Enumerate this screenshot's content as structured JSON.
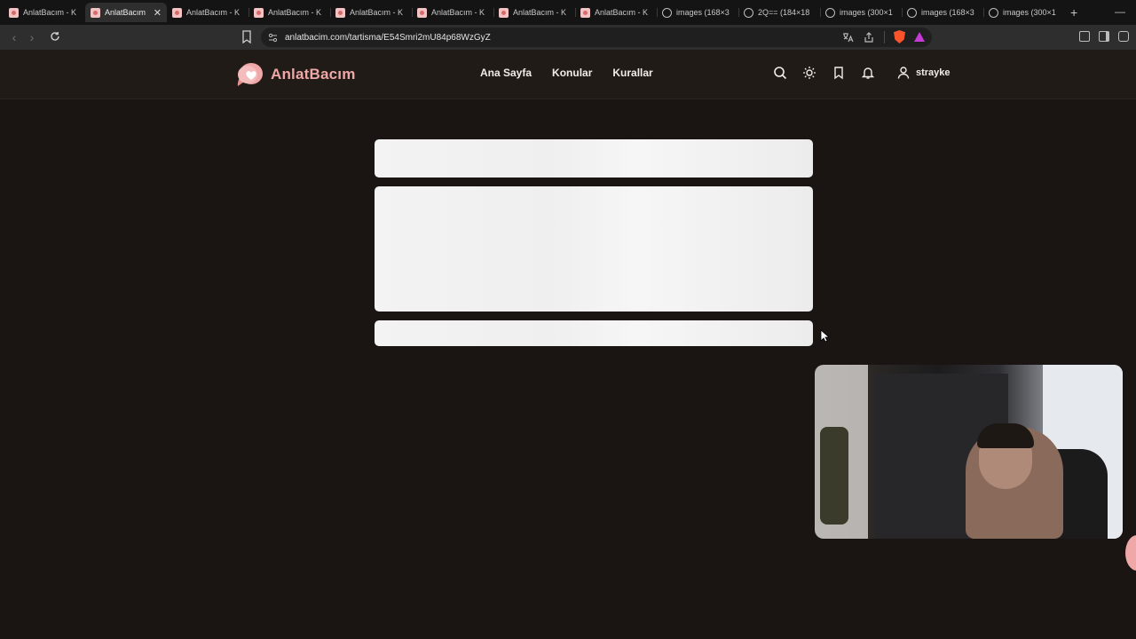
{
  "browser": {
    "tabs": [
      {
        "title": "AnlatBacım - K",
        "icon": "site-favicon",
        "active": false
      },
      {
        "title": "AnlatBacım",
        "icon": "site-favicon",
        "active": true
      },
      {
        "title": "AnlatBacım - K",
        "icon": "site-favicon",
        "active": false
      },
      {
        "title": "AnlatBacım - K",
        "icon": "site-favicon",
        "active": false
      },
      {
        "title": "AnlatBacım - K",
        "icon": "site-favicon",
        "active": false
      },
      {
        "title": "AnlatBacım - K",
        "icon": "site-favicon",
        "active": false
      },
      {
        "title": "AnlatBacım - K",
        "icon": "site-favicon",
        "active": false
      },
      {
        "title": "AnlatBacım - K",
        "icon": "site-favicon",
        "active": false
      },
      {
        "title": "images (168×3",
        "icon": "globe-icon",
        "active": false
      },
      {
        "title": "2Q== (184×18",
        "icon": "globe-icon",
        "active": false
      },
      {
        "title": "images (300×1",
        "icon": "globe-icon",
        "active": false
      },
      {
        "title": "images (168×3",
        "icon": "globe-icon",
        "active": false
      },
      {
        "title": "images (300×1",
        "icon": "globe-icon",
        "active": false
      }
    ],
    "close_glyph": "✕",
    "newtab_glyph": "+",
    "minimize_glyph": "—",
    "url": "anlatbacim.com/tartisma/E54Smri2mU84p68WzGyZ"
  },
  "site": {
    "logo_text": "AnlatBacım",
    "nav": {
      "home": "Ana Sayfa",
      "topics": "Konular",
      "rules": "Kurallar"
    },
    "username": "strayke"
  },
  "colors": {
    "brand": "#f0a7a7",
    "background": "#1a1412",
    "header": "#211b18",
    "skeleton": "#f0f0f0"
  }
}
